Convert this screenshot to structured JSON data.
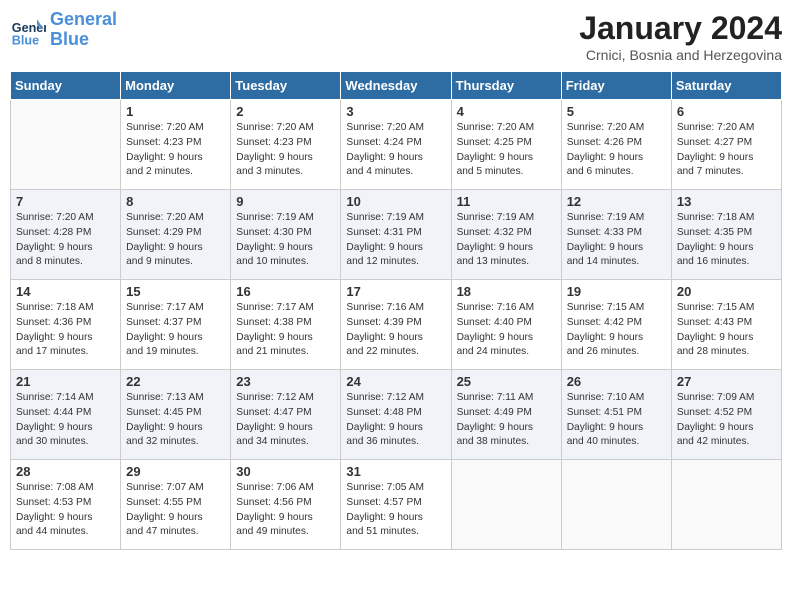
{
  "logo": {
    "line1": "General",
    "line2": "Blue"
  },
  "title": "January 2024",
  "location": "Crnici, Bosnia and Herzegovina",
  "days_header": [
    "Sunday",
    "Monday",
    "Tuesday",
    "Wednesday",
    "Thursday",
    "Friday",
    "Saturday"
  ],
  "weeks": [
    [
      {
        "num": "",
        "info": ""
      },
      {
        "num": "1",
        "info": "Sunrise: 7:20 AM\nSunset: 4:23 PM\nDaylight: 9 hours\nand 2 minutes."
      },
      {
        "num": "2",
        "info": "Sunrise: 7:20 AM\nSunset: 4:23 PM\nDaylight: 9 hours\nand 3 minutes."
      },
      {
        "num": "3",
        "info": "Sunrise: 7:20 AM\nSunset: 4:24 PM\nDaylight: 9 hours\nand 4 minutes."
      },
      {
        "num": "4",
        "info": "Sunrise: 7:20 AM\nSunset: 4:25 PM\nDaylight: 9 hours\nand 5 minutes."
      },
      {
        "num": "5",
        "info": "Sunrise: 7:20 AM\nSunset: 4:26 PM\nDaylight: 9 hours\nand 6 minutes."
      },
      {
        "num": "6",
        "info": "Sunrise: 7:20 AM\nSunset: 4:27 PM\nDaylight: 9 hours\nand 7 minutes."
      }
    ],
    [
      {
        "num": "7",
        "info": "Sunrise: 7:20 AM\nSunset: 4:28 PM\nDaylight: 9 hours\nand 8 minutes."
      },
      {
        "num": "8",
        "info": "Sunrise: 7:20 AM\nSunset: 4:29 PM\nDaylight: 9 hours\nand 9 minutes."
      },
      {
        "num": "9",
        "info": "Sunrise: 7:19 AM\nSunset: 4:30 PM\nDaylight: 9 hours\nand 10 minutes."
      },
      {
        "num": "10",
        "info": "Sunrise: 7:19 AM\nSunset: 4:31 PM\nDaylight: 9 hours\nand 12 minutes."
      },
      {
        "num": "11",
        "info": "Sunrise: 7:19 AM\nSunset: 4:32 PM\nDaylight: 9 hours\nand 13 minutes."
      },
      {
        "num": "12",
        "info": "Sunrise: 7:19 AM\nSunset: 4:33 PM\nDaylight: 9 hours\nand 14 minutes."
      },
      {
        "num": "13",
        "info": "Sunrise: 7:18 AM\nSunset: 4:35 PM\nDaylight: 9 hours\nand 16 minutes."
      }
    ],
    [
      {
        "num": "14",
        "info": "Sunrise: 7:18 AM\nSunset: 4:36 PM\nDaylight: 9 hours\nand 17 minutes."
      },
      {
        "num": "15",
        "info": "Sunrise: 7:17 AM\nSunset: 4:37 PM\nDaylight: 9 hours\nand 19 minutes."
      },
      {
        "num": "16",
        "info": "Sunrise: 7:17 AM\nSunset: 4:38 PM\nDaylight: 9 hours\nand 21 minutes."
      },
      {
        "num": "17",
        "info": "Sunrise: 7:16 AM\nSunset: 4:39 PM\nDaylight: 9 hours\nand 22 minutes."
      },
      {
        "num": "18",
        "info": "Sunrise: 7:16 AM\nSunset: 4:40 PM\nDaylight: 9 hours\nand 24 minutes."
      },
      {
        "num": "19",
        "info": "Sunrise: 7:15 AM\nSunset: 4:42 PM\nDaylight: 9 hours\nand 26 minutes."
      },
      {
        "num": "20",
        "info": "Sunrise: 7:15 AM\nSunset: 4:43 PM\nDaylight: 9 hours\nand 28 minutes."
      }
    ],
    [
      {
        "num": "21",
        "info": "Sunrise: 7:14 AM\nSunset: 4:44 PM\nDaylight: 9 hours\nand 30 minutes."
      },
      {
        "num": "22",
        "info": "Sunrise: 7:13 AM\nSunset: 4:45 PM\nDaylight: 9 hours\nand 32 minutes."
      },
      {
        "num": "23",
        "info": "Sunrise: 7:12 AM\nSunset: 4:47 PM\nDaylight: 9 hours\nand 34 minutes."
      },
      {
        "num": "24",
        "info": "Sunrise: 7:12 AM\nSunset: 4:48 PM\nDaylight: 9 hours\nand 36 minutes."
      },
      {
        "num": "25",
        "info": "Sunrise: 7:11 AM\nSunset: 4:49 PM\nDaylight: 9 hours\nand 38 minutes."
      },
      {
        "num": "26",
        "info": "Sunrise: 7:10 AM\nSunset: 4:51 PM\nDaylight: 9 hours\nand 40 minutes."
      },
      {
        "num": "27",
        "info": "Sunrise: 7:09 AM\nSunset: 4:52 PM\nDaylight: 9 hours\nand 42 minutes."
      }
    ],
    [
      {
        "num": "28",
        "info": "Sunrise: 7:08 AM\nSunset: 4:53 PM\nDaylight: 9 hours\nand 44 minutes."
      },
      {
        "num": "29",
        "info": "Sunrise: 7:07 AM\nSunset: 4:55 PM\nDaylight: 9 hours\nand 47 minutes."
      },
      {
        "num": "30",
        "info": "Sunrise: 7:06 AM\nSunset: 4:56 PM\nDaylight: 9 hours\nand 49 minutes."
      },
      {
        "num": "31",
        "info": "Sunrise: 7:05 AM\nSunset: 4:57 PM\nDaylight: 9 hours\nand 51 minutes."
      },
      {
        "num": "",
        "info": ""
      },
      {
        "num": "",
        "info": ""
      },
      {
        "num": "",
        "info": ""
      }
    ]
  ]
}
